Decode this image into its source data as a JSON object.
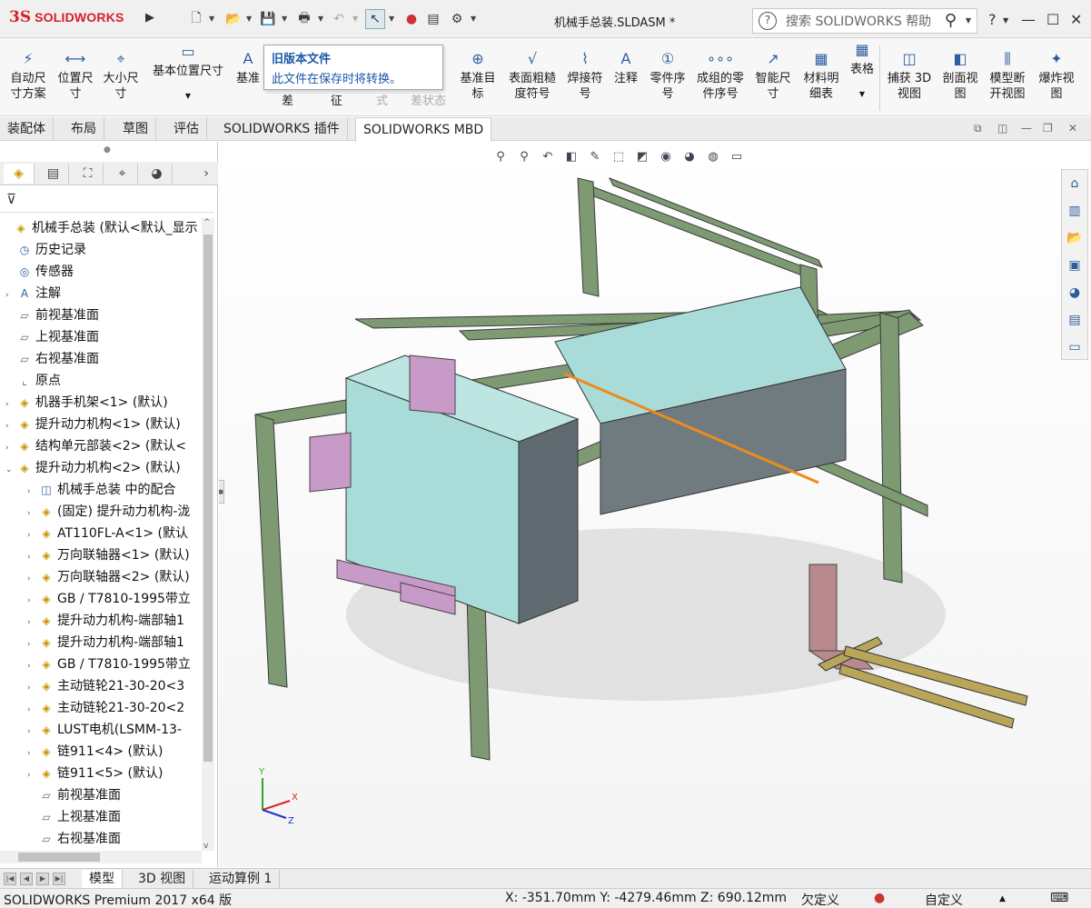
{
  "app": {
    "logo_prefix": "3S",
    "logo_text": "SOLIDWORKS",
    "document_title": "机械手总装.SLDASM *",
    "search_placeholder": "搜索 SOLIDWORKS 帮助",
    "help_label": "?"
  },
  "ribbon": {
    "buttons": [
      {
        "label1": "自动尺",
        "label2": "寸方案",
        "icon": "auto-dimension-icon"
      },
      {
        "label1": "位置尺",
        "label2": "寸",
        "icon": "location-dimension-icon"
      },
      {
        "label1": "大小尺",
        "label2": "寸",
        "icon": "size-dimension-icon"
      },
      {
        "label1": "基本位置尺寸",
        "label2": "",
        "icon": "basic-location-dimension-icon"
      },
      {
        "label1": "基准",
        "label2": "",
        "icon": "datum-icon"
      },
      {
        "label1": "差",
        "label2": "",
        "icon": ""
      },
      {
        "label1": "征",
        "label2": "",
        "icon": ""
      },
      {
        "label1": "式",
        "label2": "",
        "icon": ""
      },
      {
        "label1": "差状态",
        "label2": "",
        "icon": ""
      },
      {
        "label1": "基准目",
        "label2": "标",
        "icon": "datum-target-icon"
      },
      {
        "label1": "表面粗糙",
        "label2": "度符号",
        "icon": "surface-finish-icon"
      },
      {
        "label1": "焊接符",
        "label2": "号",
        "icon": "weld-symbol-icon"
      },
      {
        "label1": "注释",
        "label2": "",
        "icon": "note-icon"
      },
      {
        "label1": "零件序",
        "label2": "号",
        "icon": "balloon-icon"
      },
      {
        "label1": "成组的零",
        "label2": "件序号",
        "icon": "stacked-balloon-icon"
      },
      {
        "label1": "智能尺",
        "label2": "寸",
        "icon": "smart-dimension-icon"
      },
      {
        "label1": "材料明",
        "label2": "细表",
        "icon": "bom-icon"
      },
      {
        "label1": "表格",
        "label2": "",
        "icon": "table-icon"
      },
      {
        "label1": "捕获 3D",
        "label2": "视图",
        "icon": "capture-3d-view-icon"
      },
      {
        "label1": "剖面视",
        "label2": "图",
        "icon": "section-view-icon"
      },
      {
        "label1": "模型断",
        "label2": "开视图",
        "icon": "model-break-view-icon"
      },
      {
        "label1": "爆炸视",
        "label2": "图",
        "icon": "exploded-view-icon"
      }
    ]
  },
  "tooltip": {
    "title": "旧版本文件",
    "body": "此文件在保存时将转换。"
  },
  "command_tabs": [
    "装配体",
    "布局",
    "草图",
    "评估",
    "SOLIDWORKS 插件",
    "SOLIDWORKS MBD"
  ],
  "active_command_tab": "SOLIDWORKS MBD",
  "feature_tree": [
    {
      "label": "机械手总装 (默认<默认_显示",
      "level": 0,
      "expander": "",
      "icon": "assembly-icon"
    },
    {
      "label": "历史记录",
      "level": 1,
      "expander": "",
      "icon": "history-icon"
    },
    {
      "label": "传感器",
      "level": 1,
      "expander": "",
      "icon": "sensor-icon"
    },
    {
      "label": "注解",
      "level": 1,
      "expander": ">",
      "icon": "annotation-icon"
    },
    {
      "label": "前视基准面",
      "level": 1,
      "expander": "",
      "icon": "plane-icon"
    },
    {
      "label": "上视基准面",
      "level": 1,
      "expander": "",
      "icon": "plane-icon"
    },
    {
      "label": "右视基准面",
      "level": 1,
      "expander": "",
      "icon": "plane-icon"
    },
    {
      "label": "原点",
      "level": 1,
      "expander": "",
      "icon": "origin-icon"
    },
    {
      "label": "机器手机架<1> (默认)",
      "level": 1,
      "expander": ">",
      "icon": "subassembly-icon"
    },
    {
      "label": "提升动力机构<1> (默认)",
      "level": 1,
      "expander": ">",
      "icon": "subassembly-icon"
    },
    {
      "label": "结构单元部装<2> (默认<",
      "level": 1,
      "expander": ">",
      "icon": "subassembly-icon"
    },
    {
      "label": "提升动力机构<2> (默认)",
      "level": 1,
      "expander": "v",
      "icon": "subassembly-icon"
    },
    {
      "label": "机械手总装 中的配合",
      "level": 2,
      "expander": ">",
      "icon": "mates-icon"
    },
    {
      "label": "(固定) 提升动力机构-泷",
      "level": 2,
      "expander": ">",
      "icon": "part-icon"
    },
    {
      "label": "AT110FL-A<1> (默认",
      "level": 2,
      "expander": ">",
      "icon": "part-icon"
    },
    {
      "label": "万向联轴器<1> (默认)",
      "level": 2,
      "expander": ">",
      "icon": "part-icon"
    },
    {
      "label": "万向联轴器<2> (默认)",
      "level": 2,
      "expander": ">",
      "icon": "part-icon"
    },
    {
      "label": "GB / T7810-1995带立",
      "level": 2,
      "expander": ">",
      "icon": "part-icon"
    },
    {
      "label": "提升动力机构-端部轴1",
      "level": 2,
      "expander": ">",
      "icon": "part-icon"
    },
    {
      "label": "提升动力机构-端部轴1",
      "level": 2,
      "expander": ">",
      "icon": "part-icon"
    },
    {
      "label": "GB / T7810-1995带立",
      "level": 2,
      "expander": ">",
      "icon": "part-icon"
    },
    {
      "label": "主动链轮21-30-20<3",
      "level": 2,
      "expander": ">",
      "icon": "part-icon"
    },
    {
      "label": "主动链轮21-30-20<2",
      "level": 2,
      "expander": ">",
      "icon": "part-icon"
    },
    {
      "label": "LUST电机(LSMM-13-",
      "level": 2,
      "expander": ">",
      "icon": "part-icon"
    },
    {
      "label": "链911<4> (默认)",
      "level": 2,
      "expander": ">",
      "icon": "part-icon"
    },
    {
      "label": "链911<5> (默认)",
      "level": 2,
      "expander": ">",
      "icon": "part-icon"
    },
    {
      "label": "前视基准面",
      "level": 2,
      "expander": "",
      "icon": "plane-icon"
    },
    {
      "label": "上视基准面",
      "level": 2,
      "expander": "",
      "icon": "plane-icon"
    },
    {
      "label": "右视基准面",
      "level": 2,
      "expander": "",
      "icon": "plane-icon"
    }
  ],
  "bottom_tabs": [
    "模型",
    "3D 视图",
    "运动算例 1"
  ],
  "active_bottom_tab": "模型",
  "status": {
    "product": "SOLIDWORKS Premium 2017 x64 版",
    "coords": "X: -351.70mm Y: -4279.46mm Z: 690.12mm",
    "state": "欠定义",
    "units": "自定义"
  },
  "triad": {
    "x": "X",
    "y": "Y",
    "z": "Z"
  },
  "colors": {
    "accent_red": "#d5202a",
    "frame_green": "#6f8c66",
    "panel_cyan": "#a9dcd8",
    "pink_part": "#c79ac8",
    "orange_line": "#f08a1c"
  }
}
